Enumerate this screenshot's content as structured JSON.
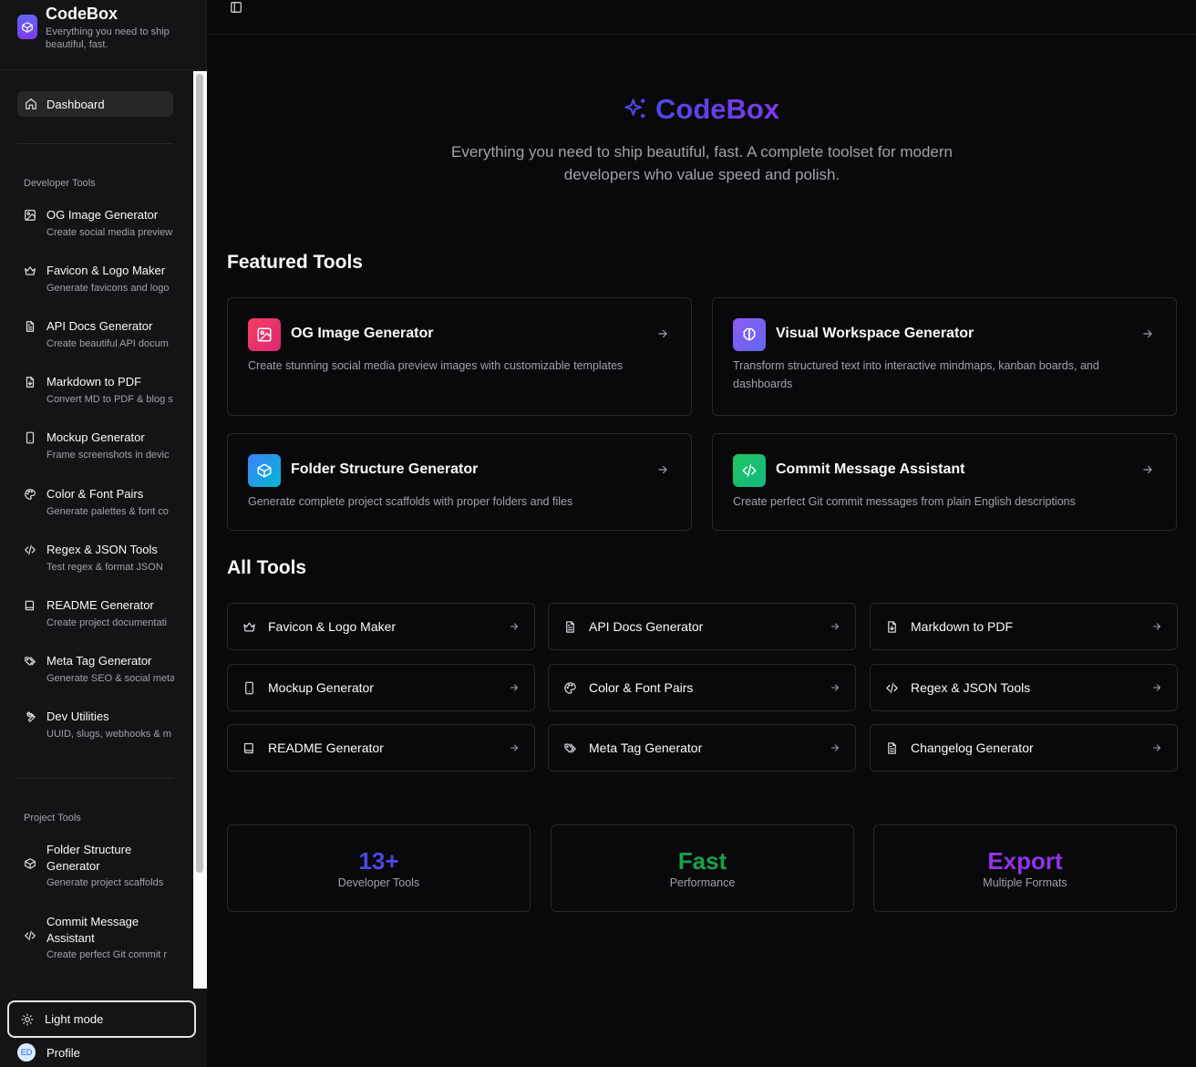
{
  "sidebar": {
    "brand": {
      "title": "CodeBox",
      "subtitle": "Everything you need to ship beautiful, fast."
    },
    "dashboard_label": "Dashboard",
    "sections": [
      {
        "label": "Developer Tools"
      },
      {
        "label": "Project Tools"
      }
    ],
    "dev_tools": [
      {
        "title": "OG Image Generator",
        "desc": "Create social media preview",
        "icon": "image-icon"
      },
      {
        "title": "Favicon & Logo Maker",
        "desc": "Generate favicons and logo",
        "icon": "crown-icon"
      },
      {
        "title": "API Docs Generator",
        "desc": "Create beautiful API docum",
        "icon": "file-text-icon"
      },
      {
        "title": "Markdown to PDF",
        "desc": "Convert MD to PDF & blog s",
        "icon": "file-down-icon"
      },
      {
        "title": "Mockup Generator",
        "desc": "Frame screenshots in devic",
        "icon": "smartphone-icon"
      },
      {
        "title": "Color & Font Pairs",
        "desc": "Generate palettes & font co",
        "icon": "palette-icon"
      },
      {
        "title": "Regex & JSON Tools",
        "desc": "Test regex & format JSON",
        "icon": "code-icon"
      },
      {
        "title": "README Generator",
        "desc": "Create project documentati",
        "icon": "book-icon"
      },
      {
        "title": "Meta Tag Generator",
        "desc": "Generate SEO & social meta",
        "icon": "tags-icon"
      },
      {
        "title": "Dev Utilities",
        "desc": "UUID, slugs, webhooks & m",
        "icon": "wrench-icon"
      }
    ],
    "project_tools": [
      {
        "title": "Folder Structure Generator",
        "desc": "Generate project scaffolds",
        "icon": "box-icon"
      },
      {
        "title": "Commit Message Assistant",
        "desc": "Create perfect Git commit r",
        "icon": "code-icon"
      }
    ],
    "light_mode_label": "Light mode",
    "profile": {
      "initials": "ED",
      "label": "Profile"
    }
  },
  "hero": {
    "title": "CodeBox",
    "subtitle": "Everything you need to ship beautiful, fast. A complete toolset for modern developers who value speed and polish."
  },
  "featured": {
    "heading": "Featured Tools",
    "cards": [
      {
        "title": "OG Image Generator",
        "desc": "Create stunning social media preview images with customizable templates",
        "icon": "image-icon",
        "color": "#e11d48"
      },
      {
        "title": "Visual Workspace Generator",
        "desc": "Transform structured text into interactive mindmaps, kanban boards, and dashboards",
        "icon": "brain-icon",
        "color": "#8b5cf6"
      },
      {
        "title": "Folder Structure Generator",
        "desc": "Generate complete project scaffolds with proper folders and files",
        "icon": "box-icon",
        "color": "#3b82f6"
      },
      {
        "title": "Commit Message Assistant",
        "desc": "Create perfect Git commit messages from plain English descriptions",
        "icon": "code-icon",
        "color": "#22c55e"
      }
    ]
  },
  "all_tools": {
    "heading": "All Tools",
    "items": [
      {
        "title": "Favicon & Logo Maker",
        "icon": "crown-icon"
      },
      {
        "title": "API Docs Generator",
        "icon": "file-text-icon"
      },
      {
        "title": "Markdown to PDF",
        "icon": "file-down-icon"
      },
      {
        "title": "Mockup Generator",
        "icon": "smartphone-icon"
      },
      {
        "title": "Color & Font Pairs",
        "icon": "palette-icon"
      },
      {
        "title": "Regex & JSON Tools",
        "icon": "code-icon"
      },
      {
        "title": "README Generator",
        "icon": "book-icon"
      },
      {
        "title": "Meta Tag Generator",
        "icon": "tags-icon"
      },
      {
        "title": "Changelog Generator",
        "icon": "file-text-icon"
      }
    ]
  },
  "stats": [
    {
      "value": "13+",
      "label": "Developer Tools",
      "color": "#4f46e5"
    },
    {
      "value": "Fast",
      "label": "Performance",
      "color": "#16a34a"
    },
    {
      "value": "Export",
      "label": "Multiple Formats",
      "color": "#9333ea"
    }
  ]
}
